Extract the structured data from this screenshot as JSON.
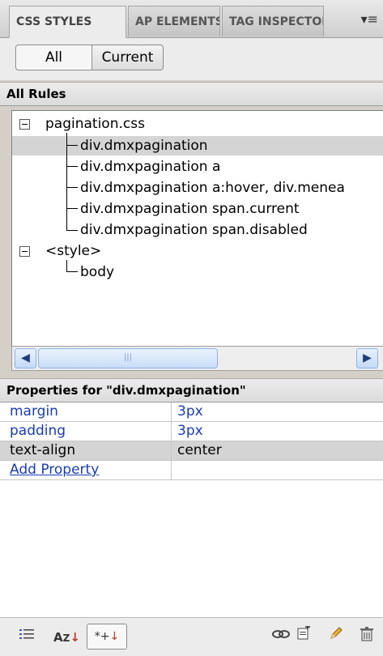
{
  "tabs": [
    {
      "label": "CSS STYLES"
    },
    {
      "label": "AP ELEMENTS"
    },
    {
      "label": "TAG INSPECTOR"
    }
  ],
  "panel_menu_icon": "panel-options-icon",
  "view_toggle": {
    "all_label": "All",
    "current_label": "Current",
    "selected": "All"
  },
  "all_rules": {
    "header": "All Rules",
    "tree": [
      {
        "label": "pagination.css"
      },
      {
        "label": "div.dmxpagination"
      },
      {
        "label": "div.dmxpagination a"
      },
      {
        "label": "div.dmxpagination a:hover, div.menea"
      },
      {
        "label": "div.dmxpagination span.current"
      },
      {
        "label": "div.dmxpagination span.disabled"
      },
      {
        "label": "<style>"
      },
      {
        "label": "body"
      }
    ],
    "selected": "div.dmxpagination"
  },
  "properties": {
    "header": "Properties for \"div.dmxpagination\"",
    "rows": [
      {
        "name": "margin",
        "value": "3px"
      },
      {
        "name": "padding",
        "value": "3px"
      },
      {
        "name": "text-align",
        "value": "center"
      }
    ],
    "add_label": "Add Property"
  },
  "toolbar_icons": [
    "category-view-icon",
    "alphabetical-view-icon",
    "set-properties-view-icon",
    "attach-stylesheet-icon",
    "new-css-rule-icon",
    "edit-style-icon",
    "delete-icon"
  ]
}
